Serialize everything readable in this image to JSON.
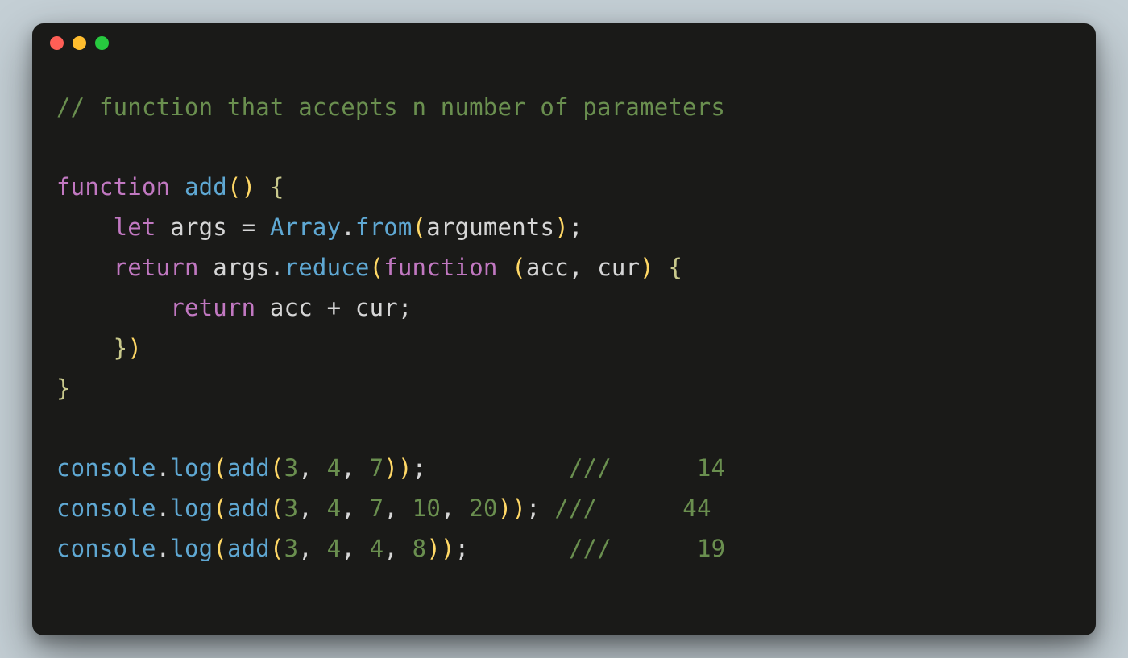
{
  "colors": {
    "bg": "#c4cfd5",
    "window": "#1a1a18",
    "comment": "#6a8f4f",
    "keyword": "#c178c1",
    "fn": "#5fa8d3",
    "paren": "#ffd866",
    "num": "#6a8f4f"
  },
  "traffic_lights": [
    "red",
    "yellow",
    "green"
  ],
  "code": {
    "comment1": "// function that accepts n number of parameters",
    "kw_function": "function",
    "fn_add": "add",
    "paren_open": "(",
    "paren_close": ")",
    "brace_open": "{",
    "brace_close": "}",
    "kw_let": "let",
    "id_args": "args",
    "op_eq": "=",
    "obj_Array": "Array",
    "dot": ".",
    "fn_from": "from",
    "id_arguments": "arguments",
    "semi": ";",
    "kw_return": "return",
    "fn_reduce": "reduce",
    "id_acc": "acc",
    "comma": ",",
    "id_cur": "cur",
    "op_plus": "+",
    "obj_console": "console",
    "fn_log": "log",
    "n3": "3",
    "n4": "4",
    "n7": "7",
    "n10": "10",
    "n20": "20",
    "n8": "8",
    "slashes": "///",
    "out14": "14",
    "out44": "44",
    "out19": "19",
    "sp1": " ",
    "sp4": "    ",
    "sp8": "        ",
    "pad1": "          ",
    "pad2": " ",
    "pad3": "      ",
    "outgap": "      "
  }
}
